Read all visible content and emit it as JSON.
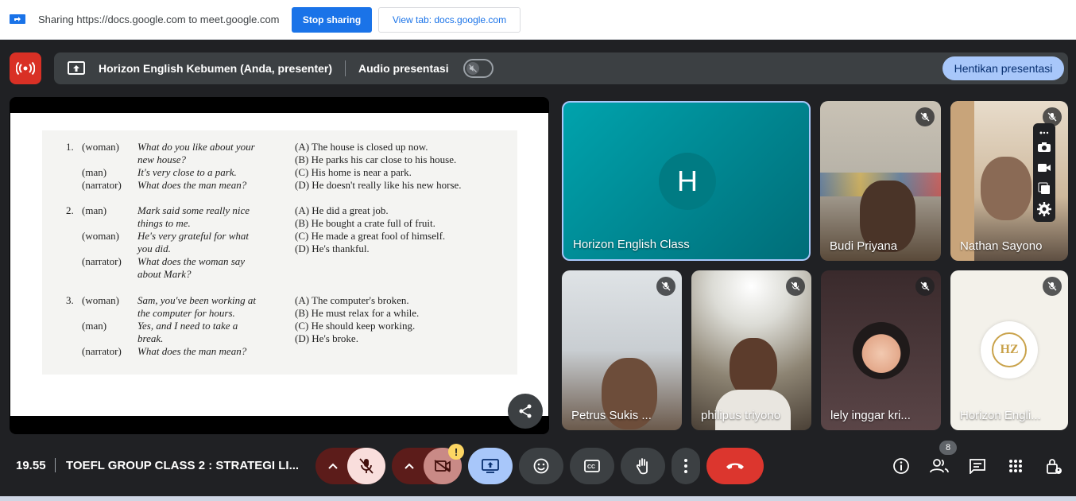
{
  "share_bar": {
    "text": "Sharing https://docs.google.com to meet.google.com",
    "stop_label": "Stop sharing",
    "view_label": "View tab: docs.google.com"
  },
  "present_bar": {
    "title": "Horizon English Kebumen (Anda, presenter)",
    "audio_label": "Audio presentasi",
    "audio_on": false,
    "stop_label": "Hentikan presentasi"
  },
  "document": {
    "questions": [
      {
        "num": "1.",
        "lines": [
          {
            "speaker": "(woman)",
            "text": "What do you like about your"
          },
          {
            "speaker": "",
            "text": "new house?"
          },
          {
            "speaker": "(man)",
            "text": "It's very close to a park."
          },
          {
            "speaker": "(narrator)",
            "text": "What does the man mean?"
          }
        ],
        "options": [
          "(A)  The house is closed up now.",
          "(B)  He parks his car close to his house.",
          "(C)  His home is near a park.",
          "(D)  He doesn't really like his new horse."
        ]
      },
      {
        "num": "2.",
        "lines": [
          {
            "speaker": "(man)",
            "text": "Mark said some really nice"
          },
          {
            "speaker": "",
            "text": "things to me."
          },
          {
            "speaker": "(woman)",
            "text": "He's very grateful for what"
          },
          {
            "speaker": "",
            "text": "you did."
          },
          {
            "speaker": "(narrator)",
            "text": "What does the woman say"
          },
          {
            "speaker": "",
            "text": "about Mark?"
          }
        ],
        "options": [
          "(A)  He did a great job.",
          "(B)  He bought a crate full of fruit.",
          "(C)  He made a great fool of himself.",
          "(D)  He's thankful."
        ]
      },
      {
        "num": "3.",
        "lines": [
          {
            "speaker": "(woman)",
            "text": "Sam, you've been working at"
          },
          {
            "speaker": "",
            "text": "the computer for hours."
          },
          {
            "speaker": "(man)",
            "text": "Yes, and I need to take a"
          },
          {
            "speaker": "",
            "text": "break."
          },
          {
            "speaker": "(narrator)",
            "text": "What does the man mean?"
          }
        ],
        "options": [
          "(A)  The computer's broken.",
          "(B)  He must relax for a while.",
          "(C)  He should keep working.",
          "(D)  He's broke."
        ]
      }
    ]
  },
  "tiles": {
    "main": {
      "name": "Horizon English Class",
      "initial": "H"
    },
    "budi": {
      "name": "Budi Priyana"
    },
    "nathan": {
      "name": "Nathan Sayono"
    },
    "petrus": {
      "name": "Petrus Sukis ..."
    },
    "philipus": {
      "name": "philipus triyono"
    },
    "lely": {
      "name": "lely inggar kri..."
    },
    "horizon2": {
      "name": "Horizon Engli...",
      "logo_text": "HZ"
    }
  },
  "footer": {
    "time": "19.55",
    "meeting_title": "TOEFL GROUP CLASS 2 : STRATEGI LI...",
    "participant_count": "8",
    "warning": "!"
  },
  "colors": {
    "accent_blue": "#1a73e8",
    "danger_red": "#d93025",
    "present_blue": "#a8c7fa",
    "background": "#202124"
  }
}
